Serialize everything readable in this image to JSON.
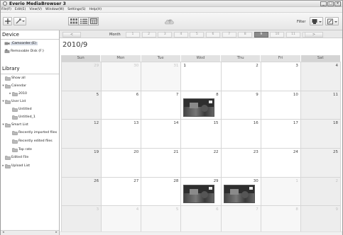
{
  "window": {
    "title": "Everio MediaBrowser 3",
    "controls": [
      "minimize",
      "maximize",
      "close"
    ]
  },
  "menu": [
    "File(F)",
    "Edit(E)",
    "View(V)",
    "Window(W)",
    "Settings(S)",
    "Help(H)"
  ],
  "toolbar": {
    "filter_label": "Filter"
  },
  "sidebar": {
    "device_header": "Device",
    "devices": [
      {
        "label": "Camcorder (E)",
        "icon": "camcorder-icon",
        "selected": true
      },
      {
        "label": "Removable Disk (F:)",
        "icon": "removable-disk-icon",
        "selected": false
      }
    ],
    "library_header": "Library",
    "library": [
      {
        "label": "Show all",
        "icon": "folder-icon",
        "indent": 0,
        "arrow": ""
      },
      {
        "label": "Calendar",
        "icon": "calendar-folder-icon",
        "indent": 0,
        "arrow": "▾"
      },
      {
        "label": "2010",
        "icon": "folder-icon",
        "indent": 1,
        "arrow": "▸"
      },
      {
        "label": "User List",
        "icon": "user-list-icon",
        "indent": 0,
        "arrow": "▾"
      },
      {
        "label": "Untitled",
        "icon": "list-icon",
        "indent": 1,
        "arrow": ""
      },
      {
        "label": "Untitled_1",
        "icon": "list-icon",
        "indent": 1,
        "arrow": ""
      },
      {
        "label": "Smart List",
        "icon": "smart-list-icon",
        "indent": 0,
        "arrow": "▾"
      },
      {
        "label": "Recently imported files",
        "icon": "smart-folder-icon",
        "indent": 1,
        "arrow": ""
      },
      {
        "label": "Recently edited files",
        "icon": "smart-folder-icon",
        "indent": 1,
        "arrow": ""
      },
      {
        "label": "Top rate",
        "icon": "smart-folder-icon",
        "indent": 1,
        "arrow": ""
      },
      {
        "label": "Edited File",
        "icon": "edited-file-icon",
        "indent": 0,
        "arrow": ""
      },
      {
        "label": "Upload List",
        "icon": "upload-list-icon",
        "indent": 0,
        "arrow": "▸"
      }
    ]
  },
  "calendar": {
    "month_label": "Month",
    "prev": "<",
    "next": ">",
    "months": [
      "1",
      "2",
      "3",
      "4",
      "5",
      "6",
      "7",
      "8",
      "9",
      "10",
      "11",
      "12"
    ],
    "active_month_index": 8,
    "year_month": "2010/9",
    "weekdays": [
      "Sun",
      "Mon",
      "Tue",
      "Wed",
      "Thu",
      "Fri",
      "Sat"
    ],
    "days": [
      {
        "n": "29",
        "other": true
      },
      {
        "n": "30",
        "other": true
      },
      {
        "n": "31",
        "other": true
      },
      {
        "n": "1",
        "first": true
      },
      {
        "n": "2"
      },
      {
        "n": "3"
      },
      {
        "n": "4"
      },
      {
        "n": "5"
      },
      {
        "n": "6"
      },
      {
        "n": "7"
      },
      {
        "n": "8",
        "thumb": true
      },
      {
        "n": "9"
      },
      {
        "n": "10"
      },
      {
        "n": "11"
      },
      {
        "n": "12"
      },
      {
        "n": "13"
      },
      {
        "n": "14"
      },
      {
        "n": "15"
      },
      {
        "n": "16"
      },
      {
        "n": "17"
      },
      {
        "n": "18"
      },
      {
        "n": "19"
      },
      {
        "n": "20"
      },
      {
        "n": "21"
      },
      {
        "n": "22"
      },
      {
        "n": "23"
      },
      {
        "n": "24"
      },
      {
        "n": "25"
      },
      {
        "n": "26"
      },
      {
        "n": "27"
      },
      {
        "n": "28"
      },
      {
        "n": "29",
        "thumb": true
      },
      {
        "n": "30",
        "thumb": true
      },
      {
        "n": "1",
        "other": true
      },
      {
        "n": "2",
        "other": true
      },
      {
        "n": "3",
        "other": true
      },
      {
        "n": "4",
        "other": true
      },
      {
        "n": "5",
        "other": true
      },
      {
        "n": "6",
        "other": true
      },
      {
        "n": "7",
        "other": true
      },
      {
        "n": "8",
        "other": true
      },
      {
        "n": "9",
        "other": true
      }
    ]
  }
}
